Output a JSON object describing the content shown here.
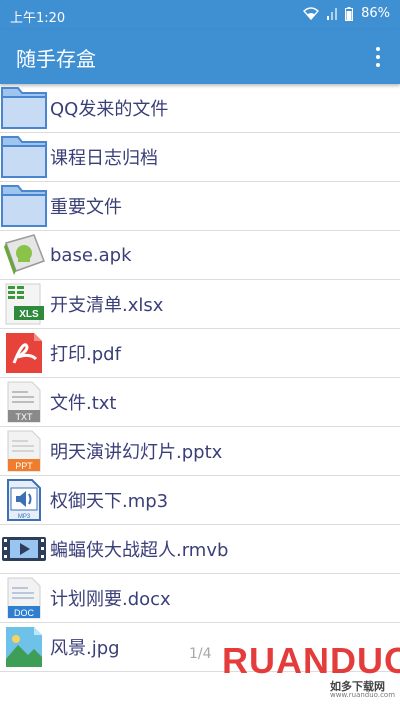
{
  "status": {
    "time": "上午1:20",
    "battery": "86%"
  },
  "app": {
    "title": "随手存盒"
  },
  "files": [
    {
      "name": "QQ发来的文件",
      "icon": "folder-icon"
    },
    {
      "name": "课程日志归档",
      "icon": "folder-icon"
    },
    {
      "name": "重要文件",
      "icon": "folder-icon"
    },
    {
      "name": "base.apk",
      "icon": "apk-icon"
    },
    {
      "name": "开支清单.xlsx",
      "icon": "excel-icon",
      "badge": "XLS"
    },
    {
      "name": "打印.pdf",
      "icon": "pdf-icon"
    },
    {
      "name": "文件.txt",
      "icon": "txt-icon",
      "badge": "TXT"
    },
    {
      "name": "明天演讲幻灯片.pptx",
      "icon": "ppt-icon",
      "badge": "PPT"
    },
    {
      "name": "权御天下.mp3",
      "icon": "audio-icon",
      "badge": "MP3"
    },
    {
      "name": "蝙蝠侠大战超人.rmvb",
      "icon": "video-icon"
    },
    {
      "name": "计划刚要.docx",
      "icon": "doc-icon",
      "badge": "DOC"
    },
    {
      "name": "风景.jpg",
      "icon": "image-icon"
    }
  ],
  "pager": "1/4",
  "watermark": {
    "brand": "RUANDUO",
    "sub": "如多下载网",
    "url": "www.ruanduo.com"
  },
  "colors": {
    "primary": "#3f8fd3",
    "text": "#3a3f78",
    "divider": "#dcdcdc"
  }
}
